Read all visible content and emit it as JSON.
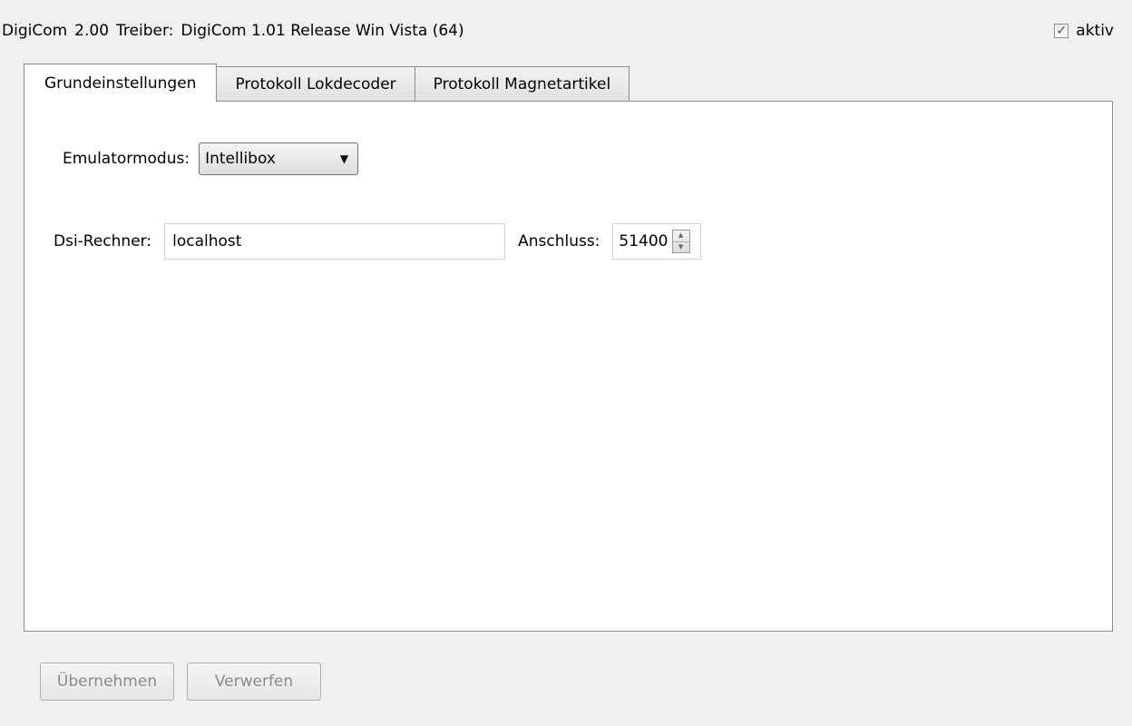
{
  "header": {
    "app_name": "DigiCom",
    "version": "2.00",
    "driver_label": "Treiber:",
    "driver_value": "DigiCom 1.01 Release Win Vista (64)",
    "active_label": "aktiv",
    "active_checked": true
  },
  "tabs": [
    {
      "label": "Grundeinstellungen",
      "active": true
    },
    {
      "label": "Protokoll Lokdecoder",
      "active": false
    },
    {
      "label": "Protokoll Magnetartikel",
      "active": false
    }
  ],
  "settings": {
    "emulator_label": "Emulatormodus:",
    "emulator_value": "Intellibox",
    "dsi_label": "Dsi-Rechner:",
    "dsi_value": "localhost",
    "port_label": "Anschluss:",
    "port_value": "51400"
  },
  "buttons": {
    "apply_label": "Übernehmen",
    "discard_label": "Verwerfen"
  },
  "icons": {
    "checkbox": "checkmark-icon",
    "combo_arrow": "chevron-down-icon",
    "spin_up": "spin-up-icon",
    "spin_down": "spin-down-icon"
  }
}
